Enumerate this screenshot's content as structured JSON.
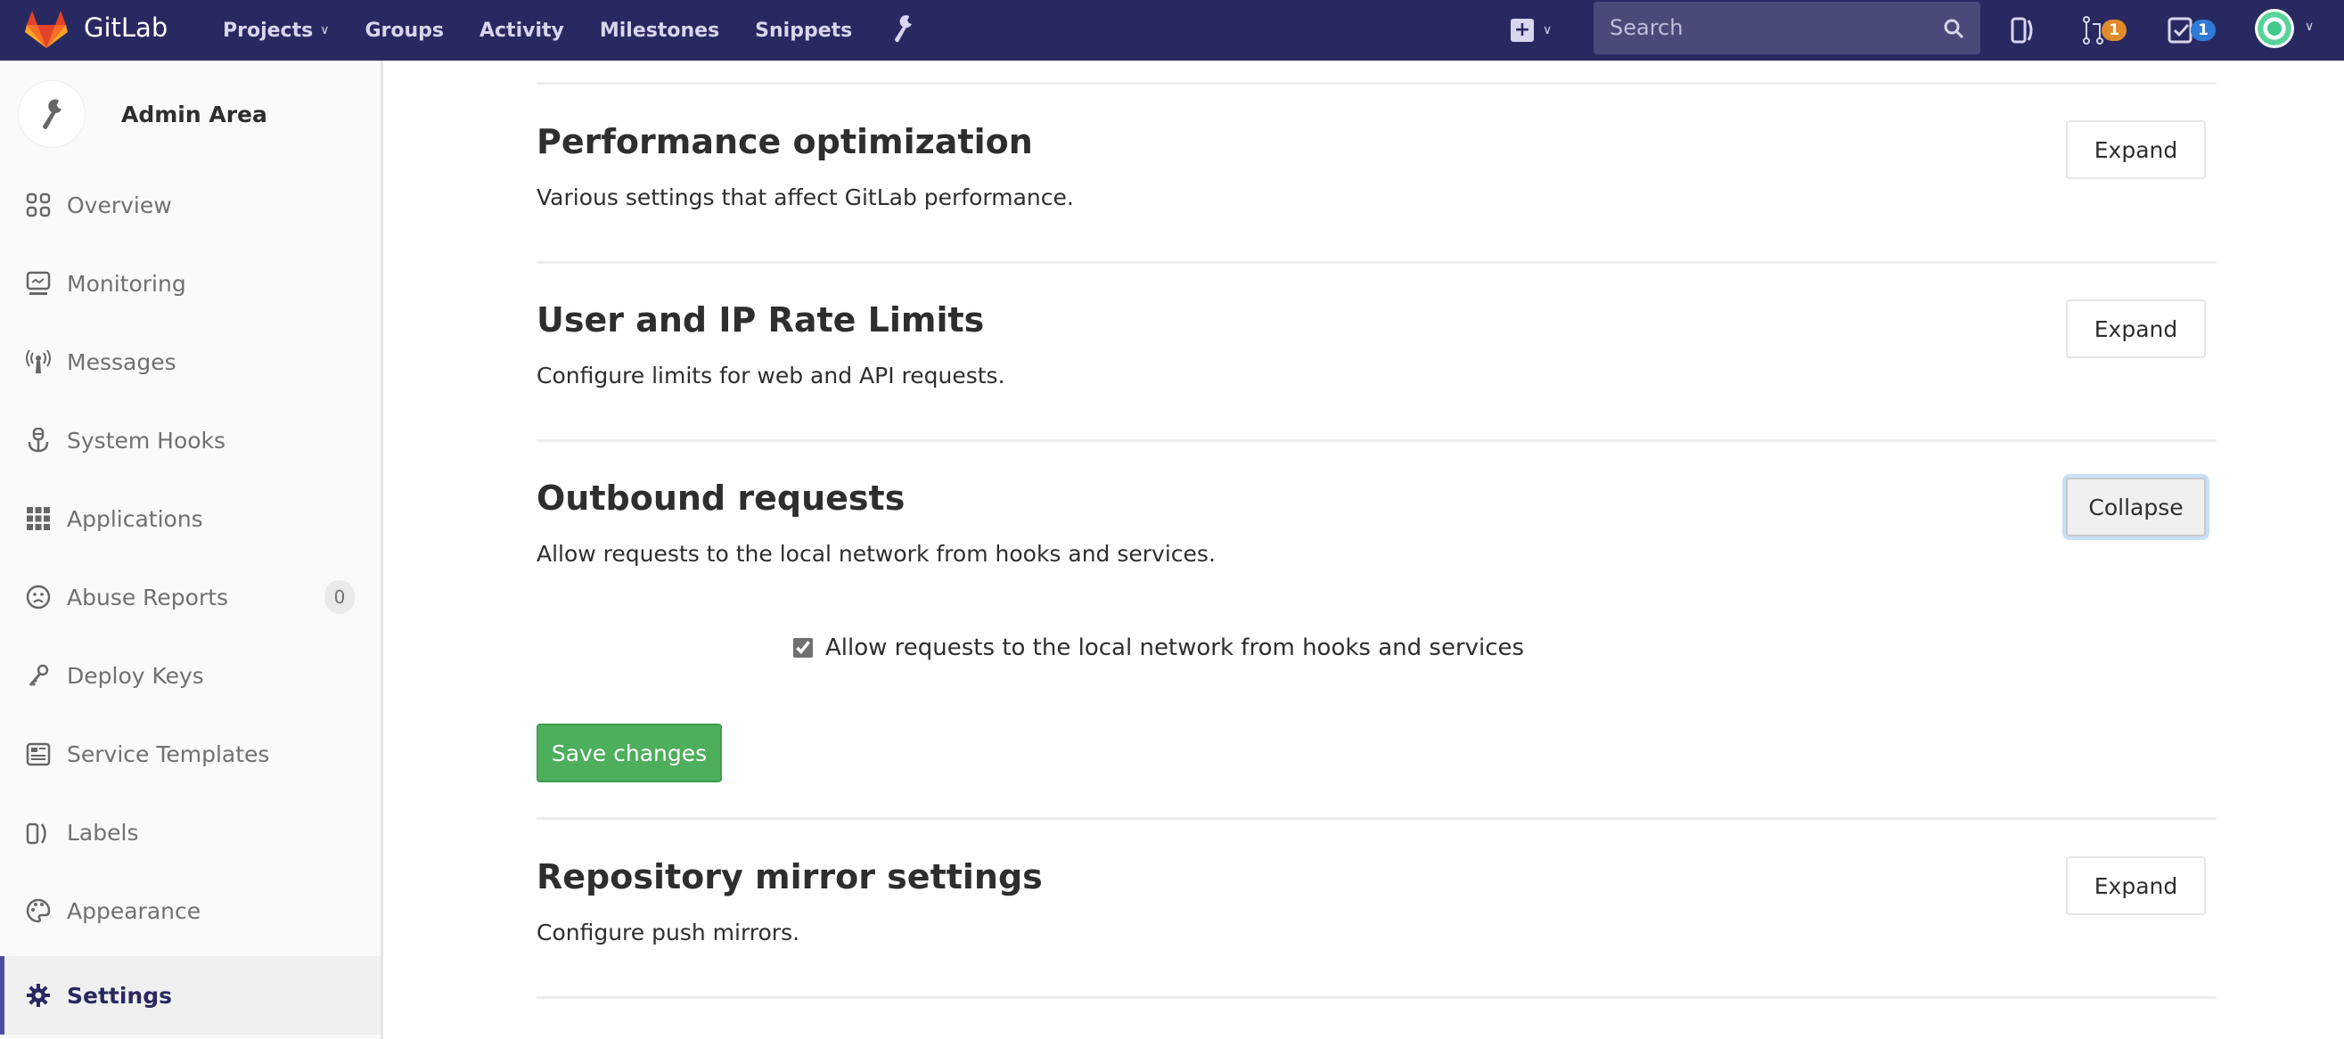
{
  "navbar": {
    "brand": "GitLab",
    "links": [
      {
        "label": "Projects",
        "has_dropdown": true
      },
      {
        "label": "Groups"
      },
      {
        "label": "Activity"
      },
      {
        "label": "Milestones"
      },
      {
        "label": "Snippets"
      }
    ],
    "admin_icon": "wrench-icon",
    "new_icon": "plus-square-icon",
    "search": {
      "placeholder": "Search",
      "value": ""
    },
    "issues_icon": "issues-icon",
    "merge_requests": {
      "icon": "merge-request-icon",
      "count": "1",
      "color": "#e18b2d"
    },
    "todos": {
      "icon": "todo-check-icon",
      "count": "1",
      "color": "#2f7bd8"
    },
    "user_avatar": "identicon-avatar"
  },
  "sidebar": {
    "context_title": "Admin Area",
    "items": [
      {
        "label": "Overview",
        "icon": "overview-grid-icon"
      },
      {
        "label": "Monitoring",
        "icon": "monitor-icon"
      },
      {
        "label": "Messages",
        "icon": "broadcast-icon"
      },
      {
        "label": "System Hooks",
        "icon": "anchor-hook-icon"
      },
      {
        "label": "Applications",
        "icon": "applications-grid-icon"
      },
      {
        "label": "Abuse Reports",
        "icon": "sad-face-icon",
        "count": "0"
      },
      {
        "label": "Deploy Keys",
        "icon": "key-icon"
      },
      {
        "label": "Service Templates",
        "icon": "template-icon"
      },
      {
        "label": "Labels",
        "icon": "labels-icon"
      },
      {
        "label": "Appearance",
        "icon": "palette-icon"
      },
      {
        "label": "Settings",
        "icon": "gear-icon",
        "active": true
      }
    ]
  },
  "sections": [
    {
      "title": "Performance optimization",
      "description": "Various settings that affect GitLab performance.",
      "button": "Expand"
    },
    {
      "title": "User and IP Rate Limits",
      "description": "Configure limits for web and API requests.",
      "button": "Expand"
    },
    {
      "title": "Outbound requests",
      "description": "Allow requests to the local network from hooks and services.",
      "button": "Collapse",
      "checkbox": {
        "label": "Allow requests to the local network from hooks and services",
        "checked": true
      },
      "save_label": "Save changes"
    },
    {
      "title": "Repository mirror settings",
      "description": "Configure push mirrors.",
      "button": "Expand"
    }
  ],
  "colors": {
    "navbar_bg": "#292961",
    "active_accent": "#4b4ba3",
    "save_green": "#4dae5c"
  }
}
